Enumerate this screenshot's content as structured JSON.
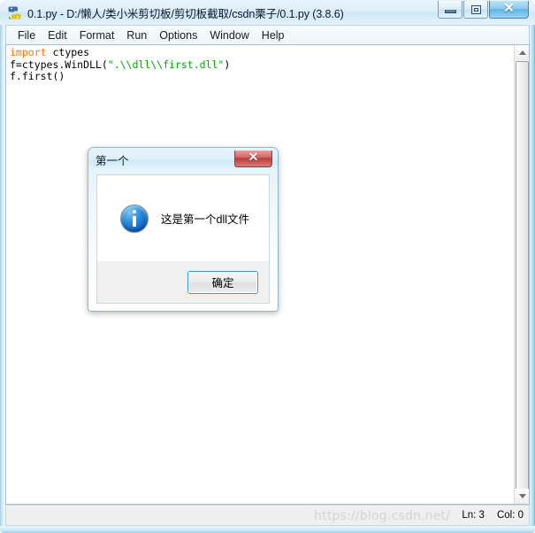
{
  "window": {
    "title": "0.1.py - D:/懒人/类小米剪切板/剪切板截取/csdn栗子/0.1.py (3.8.6)",
    "icon": "python-idle-icon",
    "controls": {
      "minimize_label": "—",
      "maximize_label": "□",
      "close_label": "✕"
    }
  },
  "menu": {
    "items": [
      {
        "label": "File"
      },
      {
        "label": "Edit"
      },
      {
        "label": "Format"
      },
      {
        "label": "Run"
      },
      {
        "label": "Options"
      },
      {
        "label": "Window"
      },
      {
        "label": "Help"
      }
    ]
  },
  "editor": {
    "lines": [
      {
        "tokens": [
          {
            "text": "import",
            "kind": "keyword"
          },
          {
            "text": " ctypes",
            "kind": "plain"
          }
        ]
      },
      {
        "tokens": [
          {
            "text": "f=ctypes.WinDLL(",
            "kind": "plain"
          },
          {
            "text": "\".\\\\dll\\\\first.dll\"",
            "kind": "string"
          },
          {
            "text": ")",
            "kind": "plain"
          }
        ]
      },
      {
        "tokens": [
          {
            "text": "f.first()",
            "kind": "plain"
          }
        ]
      }
    ],
    "colors": {
      "keyword": "#ff7700",
      "string": "#00aa00",
      "plain": "#000000",
      "background": "#ffffff"
    },
    "scrollbar": {
      "up_arrow": "scroll-up-icon",
      "down_arrow": "scroll-down-icon"
    }
  },
  "status_bar": {
    "line_label": "Ln: 3",
    "column_label": "Col: 0"
  },
  "watermark": {
    "text": "https://blog.csdn.net/"
  },
  "dialog": {
    "title": "第一个",
    "message": "这是第一个dll文件",
    "icon": "info-icon",
    "close_label": "✕",
    "ok_label": "确定",
    "colors": {
      "info_blue": "#0d5fc0",
      "close_red": "#bb3b3b",
      "focus_border": "#3c9ddb"
    }
  }
}
